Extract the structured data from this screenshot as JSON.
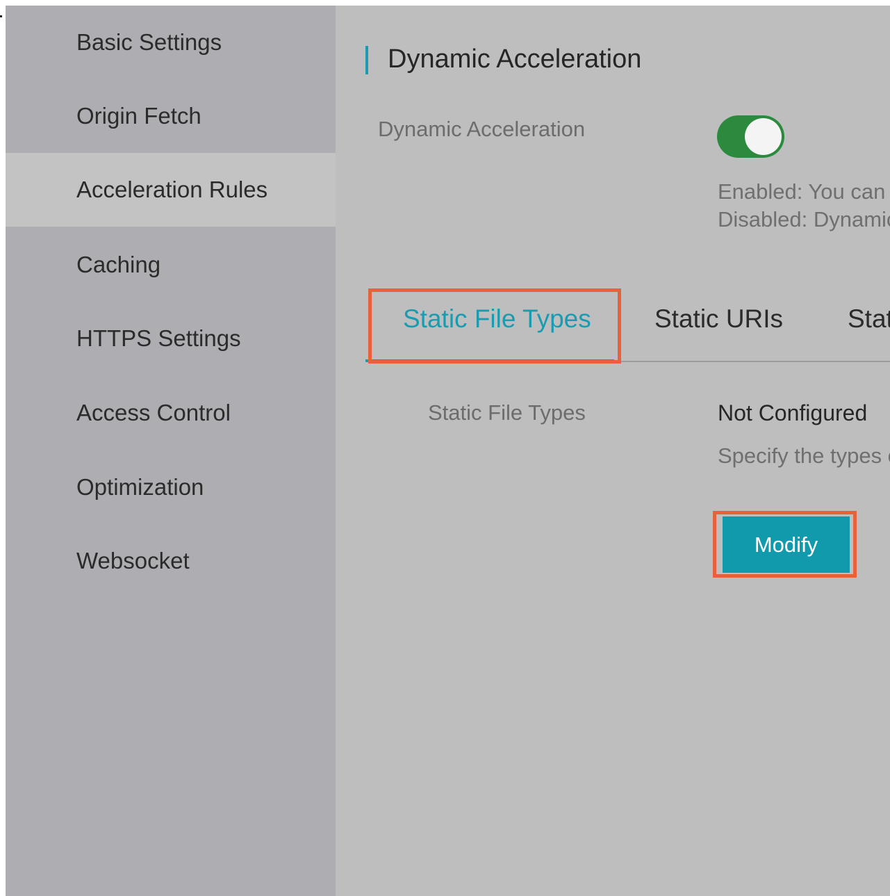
{
  "sidebar": {
    "items": [
      {
        "label": "Basic Settings",
        "active": false
      },
      {
        "label": "Origin Fetch",
        "active": false
      },
      {
        "label": "Acceleration Rules",
        "active": true
      },
      {
        "label": "Caching",
        "active": false
      },
      {
        "label": "HTTPS Settings",
        "active": false
      },
      {
        "label": "Access Control",
        "active": false
      },
      {
        "label": "Optimization",
        "active": false
      },
      {
        "label": "Websocket",
        "active": false
      }
    ]
  },
  "main": {
    "section_title": "Dynamic Acceleration",
    "dynamic_acceleration": {
      "label": "Dynamic Acceleration",
      "enabled": true,
      "hint_enabled": "Enabled: You can s",
      "hint_disabled": "Disabled: Dynamic"
    },
    "tabs": [
      {
        "label": "Static File Types",
        "active": true
      },
      {
        "label": "Static URIs",
        "active": false
      },
      {
        "label": "Stat",
        "active": false
      }
    ],
    "static_file_types": {
      "label": "Static File Types",
      "value": "Not Configured",
      "description": "Specify the types o"
    },
    "modify_button_label": "Modify"
  },
  "colors": {
    "accent": "#1a9bb0",
    "toggle_on": "#2b8a3e",
    "highlight": "#e8603c",
    "button": "#119aac"
  }
}
